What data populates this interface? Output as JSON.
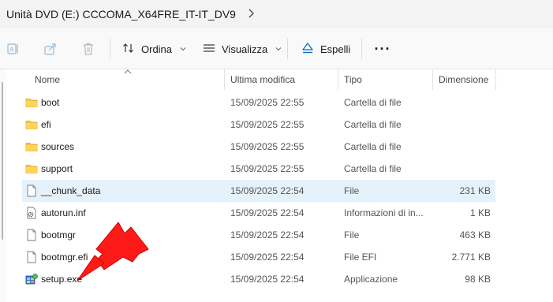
{
  "address": {
    "path": "Unità DVD (E:) CCCOMA_X64FRE_IT-IT_DV9"
  },
  "toolbar": {
    "sort_label": "Ordina",
    "view_label": "Visualizza",
    "eject_label": "Espelli",
    "more_label": "···"
  },
  "columns": {
    "name": "Nome",
    "modified": "Ultima modifica",
    "type": "Tipo",
    "size": "Dimensione"
  },
  "files": [
    {
      "name": "boot",
      "modified": "15/09/2025 22:55",
      "type": "Cartella di file",
      "size": "",
      "icon": "folder-icon"
    },
    {
      "name": "efi",
      "modified": "15/09/2025 22:55",
      "type": "Cartella di file",
      "size": "",
      "icon": "folder-icon"
    },
    {
      "name": "sources",
      "modified": "15/09/2025 22:55",
      "type": "Cartella di file",
      "size": "",
      "icon": "folder-icon"
    },
    {
      "name": "support",
      "modified": "15/09/2025 22:55",
      "type": "Cartella di file",
      "size": "",
      "icon": "folder-icon"
    },
    {
      "name": "__chunk_data",
      "modified": "15/09/2025 22:54",
      "type": "File",
      "size": "231 KB",
      "icon": "file-icon"
    },
    {
      "name": "autorun.inf",
      "modified": "15/09/2025 22:54",
      "type": "Informazioni di in...",
      "size": "1 KB",
      "icon": "settings-file-icon"
    },
    {
      "name": "bootmgr",
      "modified": "15/09/2025 22:54",
      "type": "File",
      "size": "463 KB",
      "icon": "file-icon"
    },
    {
      "name": "bootmgr.efi",
      "modified": "15/09/2025 22:54",
      "type": "File EFI",
      "size": "2.771 KB",
      "icon": "file-icon"
    },
    {
      "name": "setup.exe",
      "modified": "15/09/2025 22:54",
      "type": "Applicazione",
      "size": "98 KB",
      "icon": "setup-app-icon"
    }
  ],
  "colors": {
    "folder": "#f4c542",
    "selection": "#e5f1fb",
    "annotation_arrow": "#ff1a1a",
    "eject_accent": "#0067c0"
  }
}
